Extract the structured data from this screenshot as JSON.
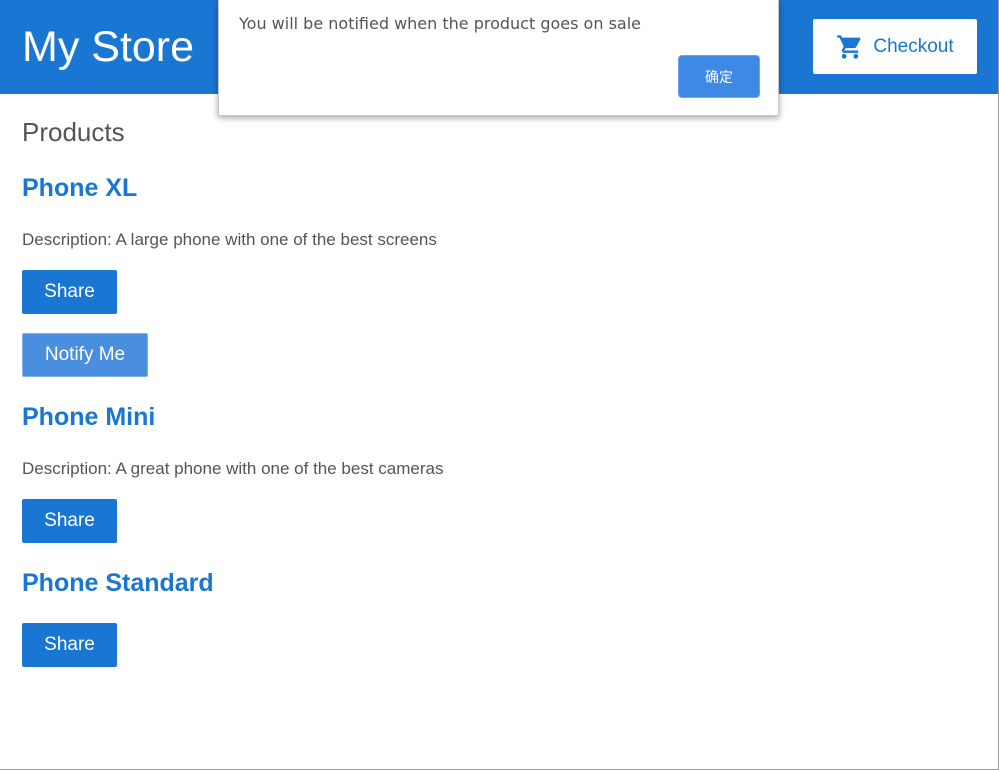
{
  "header": {
    "brand": "My Store",
    "checkout_label": "Checkout",
    "background": "#1976d2"
  },
  "main": {
    "title": "Products",
    "products": [
      {
        "name": "Phone XL",
        "description": "Description: A large phone with one of the best screens",
        "share_label": "Share",
        "notify_label": "Notify Me"
      },
      {
        "name": "Phone Mini",
        "description": "Description: A great phone with one of the best cameras",
        "share_label": "Share"
      },
      {
        "name": "Phone Standard",
        "share_label": "Share"
      }
    ]
  },
  "dialog": {
    "message": "You will be notified when the product goes on sale",
    "ok_label": "确定"
  },
  "icons": {
    "cart": "shopping-cart-icon"
  },
  "colors": {
    "accent": "#1976d2",
    "text": "#555555",
    "dialog_button": "#3f89e6"
  }
}
